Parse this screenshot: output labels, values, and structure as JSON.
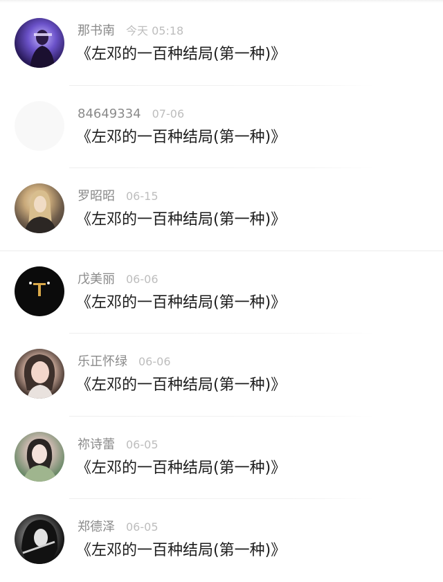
{
  "comments": [
    {
      "name": "那书南",
      "time": "今天 05:18",
      "text": "《左邓的一百种结局(第一种)》",
      "avatar": "purple-neon-portrait"
    },
    {
      "name": "84649334",
      "time": "07-06",
      "text": "《左邓的一百种结局(第一种)》",
      "avatar": "blank-avatar"
    },
    {
      "name": "罗昭昭",
      "time": "06-15",
      "text": "《左邓的一百种结局(第一种)》",
      "avatar": "blonde-portrait"
    },
    {
      "name": "戊美丽",
      "time": "06-06",
      "text": "《左邓的一百种结局(第一种)》",
      "avatar": "dark-figure"
    },
    {
      "name": "乐正怀绿",
      "time": "06-06",
      "text": "《左邓的一百种结局(第一种)》",
      "avatar": "girl-portrait"
    },
    {
      "name": "祢诗蕾",
      "time": "06-05",
      "text": "《左邓的一百种结局(第一种)》",
      "avatar": "girl-green-portrait"
    },
    {
      "name": "郑德泽",
      "time": "06-05",
      "text": "《左邓的一百种结局(第一种)》",
      "avatar": "anime-monochrome-portrait"
    }
  ]
}
